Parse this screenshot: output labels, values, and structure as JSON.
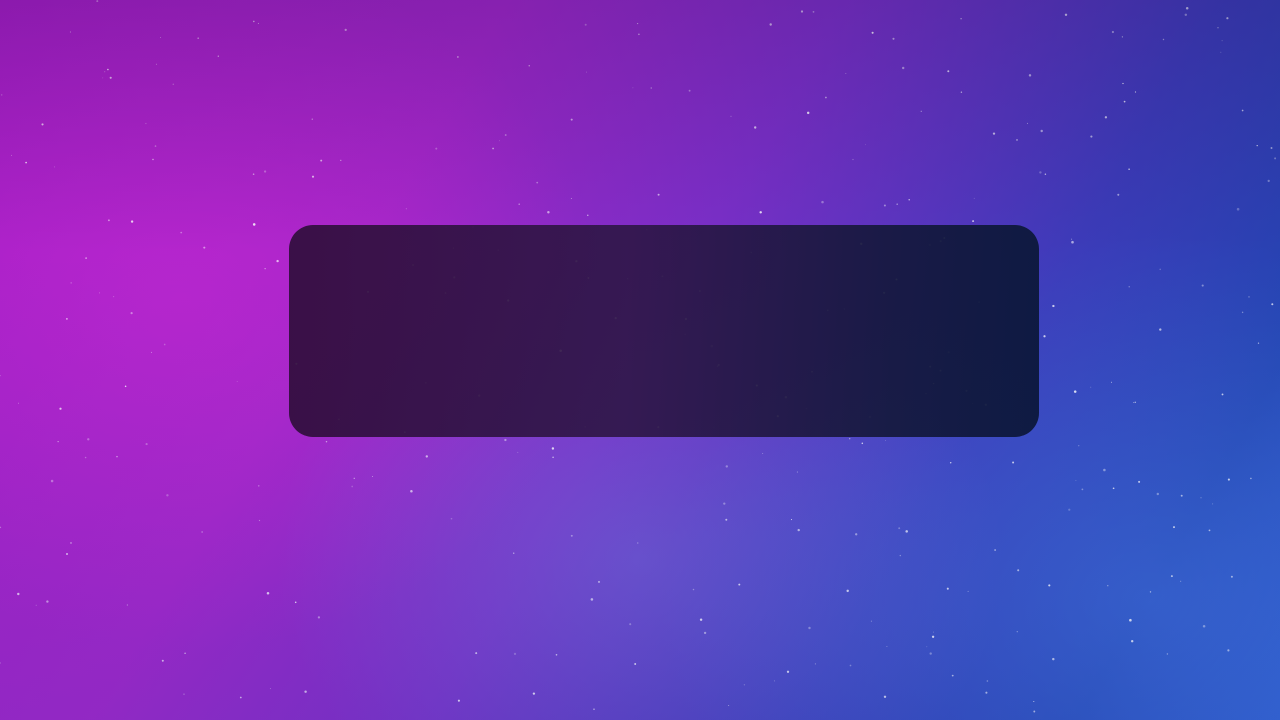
{
  "desktop": {
    "wallpaper_colors": [
      "#a51dc6",
      "#7a2fc8",
      "#2244b0",
      "#2a5ccc"
    ],
    "panel_color": "#2e1646"
  }
}
